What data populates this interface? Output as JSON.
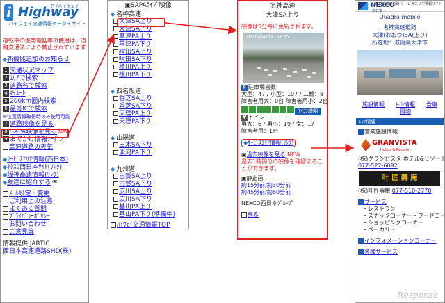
{
  "p1": {
    "logo_i": "i",
    "logo_h": "Highway",
    "logo_small": "アイハイウェイ",
    "logo_sub": "ハイウェイ交通情報ケータイサイト",
    "warning": "運転中の携帯電話等の使用は、道路交通法により禁止されています",
    "news": "新機能追加のお知らせ",
    "menu": [
      {
        "n": "1",
        "label": "交通状況マップ"
      },
      {
        "n": "2",
        "label": "ｴﾘｱで検索"
      },
      {
        "n": "3",
        "label": "道路名で検索"
      },
      {
        "n": "4",
        "label": "ﾏｲﾙｰﾄ"
      },
      {
        "n": "5",
        "label": "200km圏内検索"
      },
      {
        "n": "6",
        "label": "最寄ICで検索"
      },
      {
        "n": "",
        "label": "※位置情報取得時のみ使用可能"
      },
      {
        "n": "7",
        "label": "道路映像を見る"
      },
      {
        "n": "8",
        "label": "SAPA映像を見る"
      },
      {
        "n": "9",
        "label": "おでかけ情報ｸｰﾎﾟﾝ"
      },
      {
        "n": "",
        "label": "高速道路の天気"
      }
    ],
    "badge_new": "NEW",
    "links": [
      "ｻｰﾋﾞｽｴﾘｱ情報(西日本)",
      "ﾈｸｽｺ西日本ｻｲﾄ(ﾘﾝｸ)",
      "阪神高速情報(ﾘﾝｸ)",
      "友達に紹介する"
    ],
    "settings": [
      "ﾒｰﾙ設定・変更",
      "ご利用上の注意",
      "よくある質問",
      "ﾌﾟﾗｲﾊﾞｼｰﾎﾟﾘｼｰ",
      "お問い合わせ",
      "ご意見等"
    ],
    "provider_label": "情報提供 JARTIC",
    "provider_link": "西日本高速道路SHD(株)"
  },
  "p2": {
    "title": "SAPAﾗｲﾌﾞ映像",
    "groups": [
      {
        "name": "名神高速",
        "items": [
          "大津SA上り",
          "大津SA下り",
          "草津PA上り",
          "草津PA下り",
          "吹田SA上り",
          "吹田SA下り",
          "桂川PA上り",
          "桂川PA下り"
        ]
      },
      {
        "name": "西名阪道",
        "items": [
          "香芝SA上り",
          "香芝SA下り",
          "天理PA上り",
          "天理PA下り"
        ]
      },
      {
        "name": "山陽道",
        "items": [
          "三木SA下り",
          "淡河PA下り"
        ]
      },
      {
        "name": "九州道",
        "items": [
          "古賀SA上り",
          "古賀SA下り",
          "広川SA上り",
          "広川SA下り",
          "基山PA上り",
          "基山PA下り(準備中)"
        ]
      }
    ],
    "top_link": "ﾊｲｳｪｲ交通情報TOP"
  },
  "p3": {
    "title1": "名神高速",
    "title2": "大津SA上り",
    "update": "映像は5分毎に更新されます。",
    "timestamp": "2010/04/21 10:25",
    "parking_title": "駐車場台数",
    "parking_1": "大型：47 / 小型：107 / 二輪：8",
    "parking_2": "障害者用大：0台 障害者用小：2台",
    "toilet_title": "トイレ",
    "toilet_1": "男大：6 / 男小：19 / 女：17",
    "toilet_2": "障害者用：1台",
    "sa_info": "ｻｰﾋﾞｽｴﾘｱ情報(ﾘﾝｸ)",
    "past_video": "過去映像を見る",
    "past_note": "過去1時間分の映像を確認することができます。",
    "still_title": "静止画",
    "still_links": [
      "約15分前",
      "約30分前",
      "約45分前",
      "約60分前"
    ],
    "group": "NEXCO西日本ｸﾞﾙｰﾌﾟ",
    "back": "戻る",
    "icon_label": "ｱｲｺﾝ説明"
  },
  "p4": {
    "brand": "NEXCO",
    "brand_sub": "西日本",
    "site_name": "西日本高速道路 サービスエリア情報サイト",
    "mobile": "Quadra mobile",
    "road": "名神高速道路",
    "sa_name": "大津(おおつ)SA(上り)",
    "address": "所在地：滋賀県大津市",
    "tabs": [
      "施設情報",
      "ﾄｲﾚ情報",
      "買物",
      "食事"
    ],
    "area_bar": "ｴﾘｱ情報",
    "shop_title": "営業施設情報",
    "shop1_logo": "GRANVISTA",
    "shop1_logo_sub": "Hotels & Resorts",
    "shop1": "(株)グランビスタ ホテル&リゾート",
    "shop1_tel": "077-522-6092",
    "shop2_logo": "叶 匠 壽 庵",
    "shop2": "(株)叶匠壽庵",
    "shop2_tel": "077-510-2770",
    "services_title": "サービス",
    "services": [
      "・レストラン",
      "・スナックコーナー・フードコート",
      "・ショッピングコーナー",
      "・ベーカリー"
    ],
    "info_link": "インフォメーションコーナー",
    "other_link": "各種サービス"
  },
  "watermark": "Response."
}
